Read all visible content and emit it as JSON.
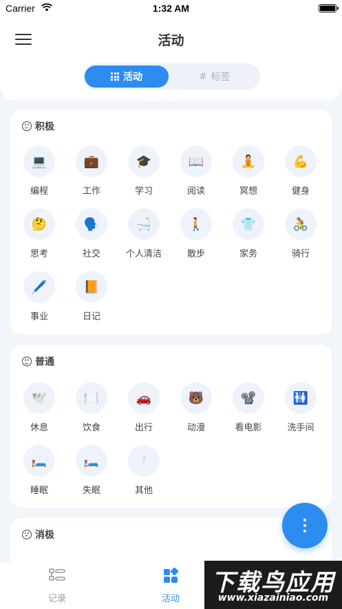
{
  "status_bar": {
    "carrier": "Carrier",
    "time": "1:32 AM"
  },
  "header": {
    "title": "活动"
  },
  "segmented": {
    "activity_label": "活动",
    "tags_label": "标签"
  },
  "sections": [
    {
      "title": "积极",
      "items": [
        {
          "label": "编程",
          "icon": "💻"
        },
        {
          "label": "工作",
          "icon": "💼"
        },
        {
          "label": "学习",
          "icon": "🎓"
        },
        {
          "label": "阅读",
          "icon": "📖"
        },
        {
          "label": "冥想",
          "icon": "🧘"
        },
        {
          "label": "健身",
          "icon": "💪"
        },
        {
          "label": "思考",
          "icon": "🤔"
        },
        {
          "label": "社交",
          "icon": "🗣️"
        },
        {
          "label": "个人清洁",
          "icon": "🛁"
        },
        {
          "label": "散步",
          "icon": "🚶"
        },
        {
          "label": "家务",
          "icon": "👕"
        },
        {
          "label": "骑行",
          "icon": "🚴"
        },
        {
          "label": "事业",
          "icon": "🖊️"
        },
        {
          "label": "日记",
          "icon": "📙"
        }
      ]
    },
    {
      "title": "普通",
      "items": [
        {
          "label": "休息",
          "icon": "🕊️"
        },
        {
          "label": "饮食",
          "icon": "🍽️"
        },
        {
          "label": "出行",
          "icon": "🚗"
        },
        {
          "label": "动漫",
          "icon": "🐻"
        },
        {
          "label": "看电影",
          "icon": "📽️"
        },
        {
          "label": "洗手间",
          "icon": "🚻"
        },
        {
          "label": "睡眠",
          "icon": "🛏️"
        },
        {
          "label": "失眠",
          "icon": "🛏️"
        },
        {
          "label": "其他",
          "icon": "?"
        }
      ]
    },
    {
      "title": "消极",
      "items": []
    }
  ],
  "tabbar": {
    "records_label": "记录",
    "activity_label": "活动"
  },
  "watermark": {
    "main": "下载鸟应用",
    "url": "www.xiazainiao.com"
  },
  "colors": {
    "accent": "#2d8cf0",
    "background": "#f2f5fa",
    "icon_bg": "#eef3fb"
  }
}
